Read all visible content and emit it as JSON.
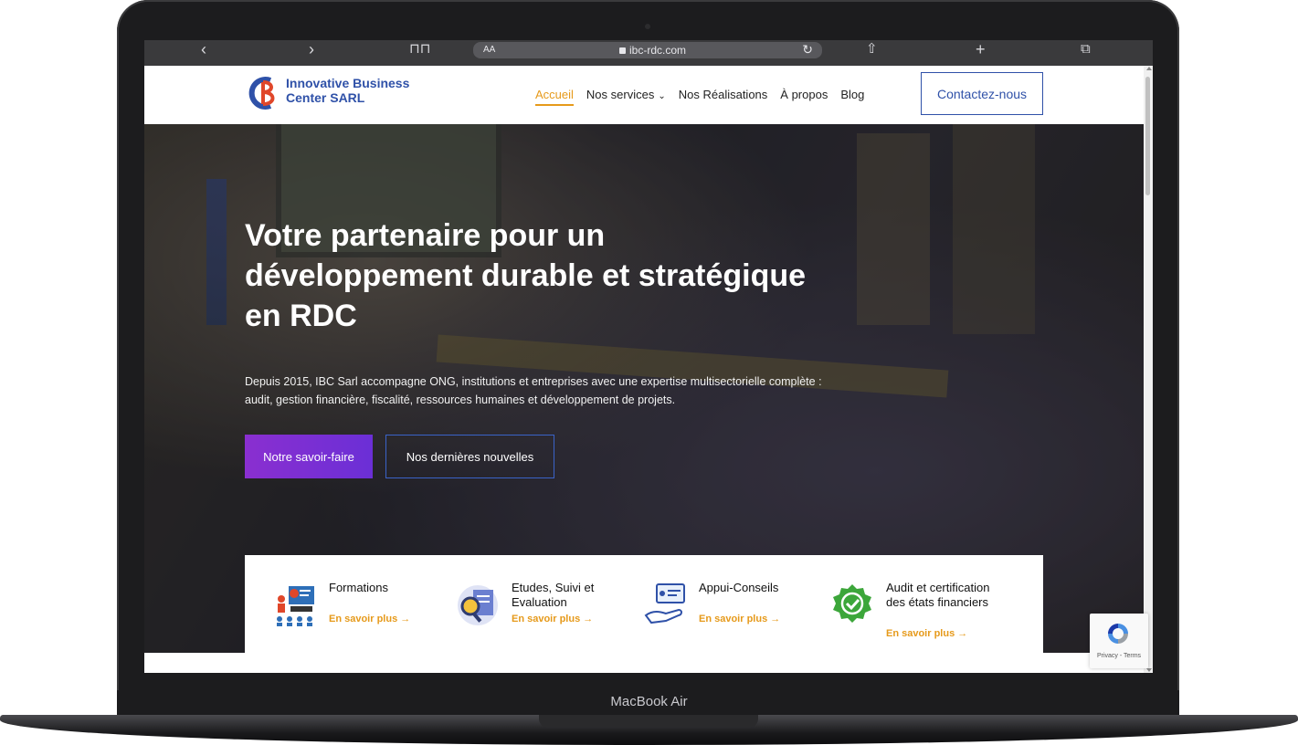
{
  "device": {
    "label": "MacBook Air"
  },
  "browser": {
    "text_size_label": "AA",
    "url": "ibc-rdc.com",
    "icons": [
      "back-arrow-icon",
      "forward-arrow-icon",
      "bookmarks-icon",
      "reload-icon",
      "share-icon",
      "new-tab-icon",
      "tabs-icon"
    ]
  },
  "header": {
    "logo_text": "Innovative Business Center SARL",
    "nav": [
      {
        "label": "Accueil",
        "active": true
      },
      {
        "label": "Nos services",
        "dropdown": true
      },
      {
        "label": "Nos Réalisations"
      },
      {
        "label": "À propos"
      },
      {
        "label": "Blog"
      }
    ],
    "cta_label": "Contactez-nous"
  },
  "hero": {
    "title": "Votre partenaire pour un développement durable et stratégique en RDC",
    "description": "Depuis 2015, IBC Sarl accompagne ONG, institutions et entreprises avec une expertise multisectorielle complète : audit, gestion financière, fiscalité, ressources humaines et développement de projets.",
    "primary_button": "Notre savoir-faire",
    "secondary_button": "Nos dernières nouvelles"
  },
  "services": [
    {
      "title": "Formations",
      "link": "En savoir plus →",
      "icon": "training-icon"
    },
    {
      "title": "Etudes, Suivi et Evaluation",
      "link": "En savoir plus →",
      "icon": "evaluation-icon"
    },
    {
      "title": "Appui-Conseils",
      "link": "En savoir plus →",
      "icon": "advice-icon"
    },
    {
      "title": "Audit et certification des états financiers",
      "link": "En savoir plus →",
      "icon": "audit-badge-icon"
    }
  ],
  "recaptcha": {
    "text": "Privacy - Terms"
  },
  "colors": {
    "brand_blue": "#2f51a8",
    "accent_orange": "#e69a1b",
    "button_purple": "#7a2fd3"
  }
}
